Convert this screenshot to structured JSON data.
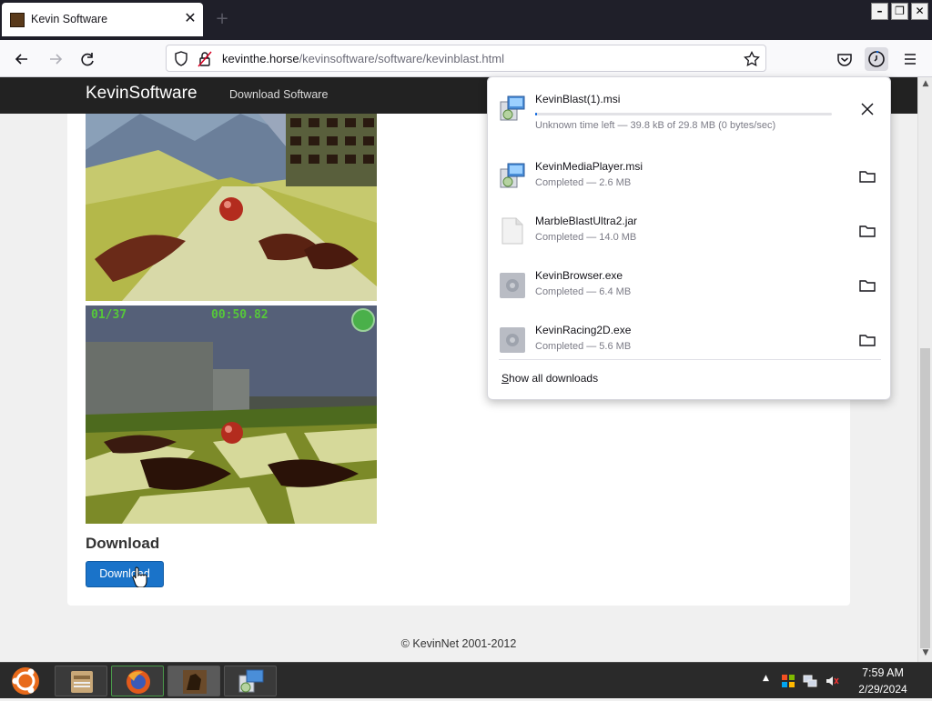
{
  "browser": {
    "tab": {
      "title": "Kevin Software"
    },
    "url": {
      "host": "kevinthe.horse",
      "path": "/kevinsoftware/software/kevinblast.html"
    },
    "window_controls": {
      "minimize": "–",
      "restore": "❐",
      "close": "✕"
    }
  },
  "site": {
    "brand": "KevinSoftware",
    "nav_link": "Download Software",
    "download_heading": "Download",
    "download_button": "Download",
    "footer": "© KevinNet 2001-2012",
    "screenshot2_hud": {
      "left": "01/37",
      "center": "00:50.82"
    }
  },
  "downloads": {
    "items": [
      {
        "name": "KevinBlast(1).msi",
        "status": "Unknown time left — 39.8 kB of 29.8 MB (0 bytes/sec)",
        "in_progress": true,
        "progress": 0.0013,
        "icon": "msi-installer-icon"
      },
      {
        "name": "KevinMediaPlayer.msi",
        "status": "Completed — 2.6 MB",
        "in_progress": false,
        "icon": "msi-installer-icon"
      },
      {
        "name": "MarbleBlastUltra2.jar",
        "status": "Completed — 14.0 MB",
        "in_progress": false,
        "icon": "generic-file-icon"
      },
      {
        "name": "KevinBrowser.exe",
        "status": "Completed — 6.4 MB",
        "in_progress": false,
        "icon": "exe-icon"
      },
      {
        "name": "KevinRacing2D.exe",
        "status": "Completed — 5.6 MB",
        "in_progress": false,
        "icon": "exe-icon"
      }
    ],
    "show_all": "Show all downloads"
  },
  "taskbar": {
    "time": "7:59 AM",
    "date": "2/29/2024"
  },
  "colors": {
    "accent": "#0060df",
    "download_button": "#1a73c9",
    "site_nav": "#222222",
    "taskbar": "#2a2a2a"
  }
}
